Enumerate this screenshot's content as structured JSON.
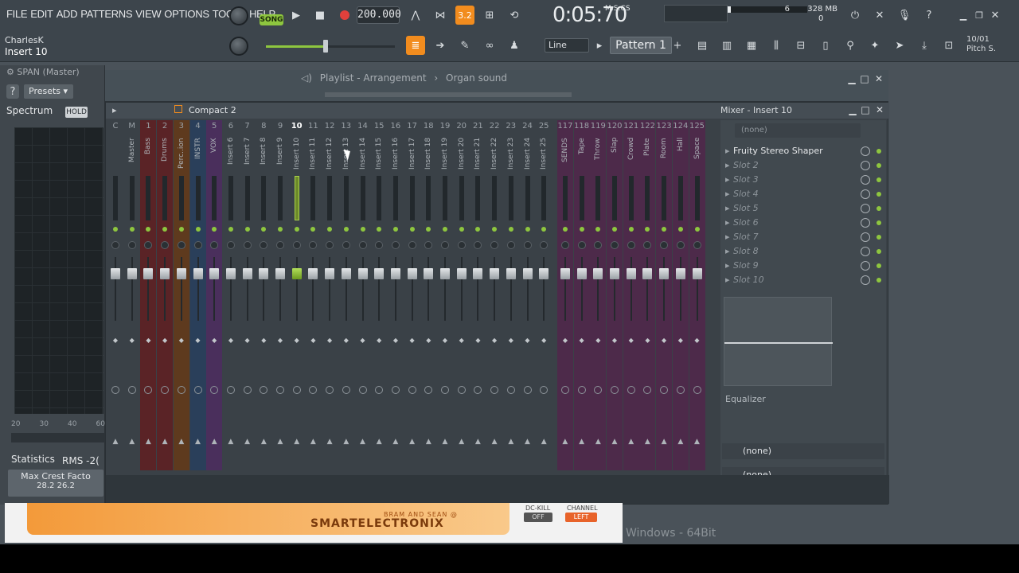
{
  "menu": [
    "FILE",
    "EDIT",
    "ADD",
    "PATTERNS",
    "VIEW",
    "OPTIONS",
    "TOOLS",
    "HELP"
  ],
  "hint": {
    "user": "CharlesK",
    "target": "Insert 10"
  },
  "transport": {
    "song_label": "SONG",
    "tempo": "200.000",
    "time": "0:05:70",
    "time_unit": "M:S:CS"
  },
  "cpu": {
    "cores": "6",
    "memory": "328 MB",
    "polyphony": "0"
  },
  "snap": "Line",
  "pattern": "Pattern 1",
  "hint_right": {
    "line1": "10/01",
    "line2": "Pitch S."
  },
  "plugin": {
    "title": "SPAN (Master)",
    "presets": "Presets",
    "tab": "Spectrum",
    "hold": "HOLD",
    "axis": [
      "20",
      "30",
      "40",
      "60"
    ],
    "statistics": "Statistics",
    "rms": "RMS",
    "rms_value": "-2(",
    "crest_label": "Max Crest Facto",
    "crest_values": "28.2  26.2"
  },
  "playlist": {
    "path": [
      "Playlist - Arrangement",
      "Organ sound"
    ]
  },
  "mixer": {
    "view": "Compact 2",
    "title": "Mixer - Insert 10",
    "tracks": [
      {
        "num": "C",
        "name": "",
        "color": "#3a4147"
      },
      {
        "num": "M",
        "name": "Master",
        "color": "#3a4147"
      },
      {
        "num": "1",
        "name": "Bass",
        "color": "#5a2326"
      },
      {
        "num": "2",
        "name": "Drums",
        "color": "#5a2326"
      },
      {
        "num": "3",
        "name": "Perc..ion",
        "color": "#5e3a1e"
      },
      {
        "num": "4",
        "name": "INSTR",
        "color": "#2a3f5a"
      },
      {
        "num": "5",
        "name": "VOX",
        "color": "#4a2f5c"
      },
      {
        "num": "6",
        "name": "Insert 6",
        "color": "#3a4147"
      },
      {
        "num": "7",
        "name": "Insert 7",
        "color": "#3a4147"
      },
      {
        "num": "8",
        "name": "Insert 8",
        "color": "#3a4147"
      },
      {
        "num": "9",
        "name": "Insert 9",
        "color": "#3a4147"
      },
      {
        "num": "10",
        "name": "Insert 10",
        "color": "#3a4147"
      },
      {
        "num": "11",
        "name": "Insert 11",
        "color": "#3a4147"
      },
      {
        "num": "12",
        "name": "Insert 12",
        "color": "#3a4147"
      },
      {
        "num": "13",
        "name": "Insert 13",
        "color": "#3a4147"
      },
      {
        "num": "14",
        "name": "Insert 14",
        "color": "#3a4147"
      },
      {
        "num": "15",
        "name": "Insert 15",
        "color": "#3a4147"
      },
      {
        "num": "16",
        "name": "Insert 16",
        "color": "#3a4147"
      },
      {
        "num": "17",
        "name": "Insert 17",
        "color": "#3a4147"
      },
      {
        "num": "18",
        "name": "Insert 18",
        "color": "#3a4147"
      },
      {
        "num": "19",
        "name": "Insert 19",
        "color": "#3a4147"
      },
      {
        "num": "20",
        "name": "Insert 20",
        "color": "#3a4147"
      },
      {
        "num": "21",
        "name": "Insert 21",
        "color": "#3a4147"
      },
      {
        "num": "22",
        "name": "Insert 22",
        "color": "#3a4147"
      },
      {
        "num": "23",
        "name": "Insert 23",
        "color": "#3a4147"
      },
      {
        "num": "24",
        "name": "Insert 24",
        "color": "#3a4147"
      },
      {
        "num": "25",
        "name": "Insert 25",
        "color": "#3a4147"
      },
      {
        "num": "117",
        "name": "SENDS",
        "color": "#4d2a4a"
      },
      {
        "num": "118",
        "name": "Tape",
        "color": "#4d2a4a"
      },
      {
        "num": "119",
        "name": "Throw",
        "color": "#4d2a4a"
      },
      {
        "num": "120",
        "name": "Slap",
        "color": "#4d2a4a"
      },
      {
        "num": "121",
        "name": "Crowd",
        "color": "#4d2a4a"
      },
      {
        "num": "122",
        "name": "Plate",
        "color": "#4d2a4a"
      },
      {
        "num": "123",
        "name": "Room",
        "color": "#4d2a4a"
      },
      {
        "num": "124",
        "name": "Hall",
        "color": "#4d2a4a"
      },
      {
        "num": "125",
        "name": "Space",
        "color": "#4d2a4a"
      }
    ],
    "selected_track": "10",
    "input": "(none)",
    "slots": [
      "Fruity Stereo Shaper",
      "Slot 2",
      "Slot 3",
      "Slot 4",
      "Slot 5",
      "Slot 6",
      "Slot 7",
      "Slot 8",
      "Slot 9",
      "Slot 10"
    ],
    "equalizer": "Equalizer",
    "output1": "(none)",
    "output2": "(none)"
  },
  "banner": {
    "brand_line1": "BRAM AND SEAN @",
    "brand_line2": "SMARTELECTRONIX",
    "dc_label": "DC-KILL",
    "dc_value": "OFF",
    "channel_label": "CHANNEL",
    "channel_value": "LEFT"
  },
  "os_label": "Windows - 64Bit",
  "colors": {
    "accent": "#8ec63f",
    "record": "#e0403c",
    "banner": "#f39a3a"
  }
}
